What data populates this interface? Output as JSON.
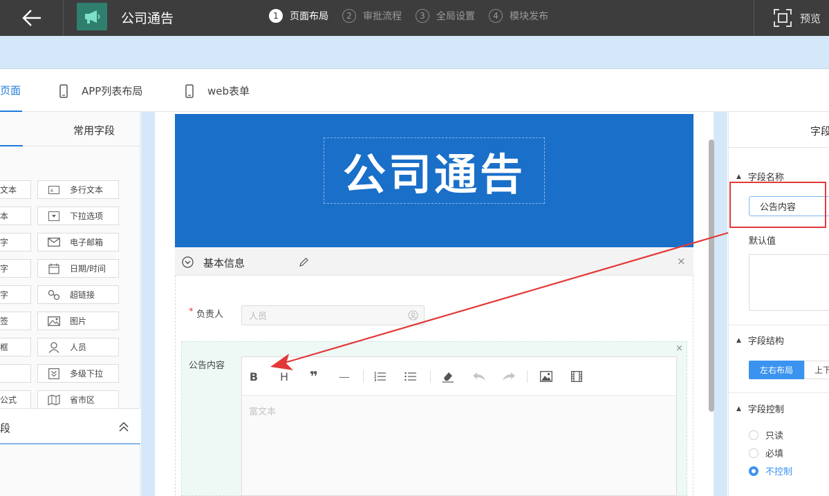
{
  "header": {
    "app_title": "公司通告",
    "steps": [
      {
        "num": "1",
        "label": "页面布局"
      },
      {
        "num": "2",
        "label": "审批流程"
      },
      {
        "num": "3",
        "label": "全局设置"
      },
      {
        "num": "4",
        "label": "模块发布"
      }
    ],
    "preview_label": "预览"
  },
  "tabs": {
    "page": "页面",
    "app_list": "APP列表布局",
    "web_form": "web表单"
  },
  "left_panel": {
    "tab_label": "常用字段",
    "fields_left": [
      "文本",
      "本",
      "字",
      "字",
      "字",
      "签",
      "框",
      "",
      "公式"
    ],
    "fields_right": [
      "多行文本",
      "下拉选项",
      "电子邮箱",
      "日期/时间",
      "超链接",
      "图片",
      "人员",
      "多级下拉",
      "省市区"
    ],
    "section_label": "段"
  },
  "canvas": {
    "banner_title": "公司通告",
    "group_title": "基本信息",
    "close": "×",
    "required_mark": "*",
    "owner_label": "负责人",
    "owner_placeholder": "人员",
    "content_label": "公告内容",
    "editor_placeholder": "富文本",
    "toolbar": {
      "bold": "B",
      "heading": "H",
      "quote": "❞",
      "hr": "—"
    }
  },
  "right_panel": {
    "head_label": "字段",
    "field_name_label": "字段名称",
    "field_name_value": "公告内容",
    "default_label": "默认值",
    "structure_label": "字段结构",
    "layout_lr": "左右布局",
    "layout_ud": "上下",
    "control_label": "字段控制",
    "control_options": [
      "只读",
      "必填",
      "不控制"
    ],
    "control_selected": "不控制"
  },
  "colors": {
    "topbar": "#3d3d3d",
    "accent": "#1f7ad9",
    "banner": "#1a6fc9",
    "annotation": "#e23838"
  }
}
